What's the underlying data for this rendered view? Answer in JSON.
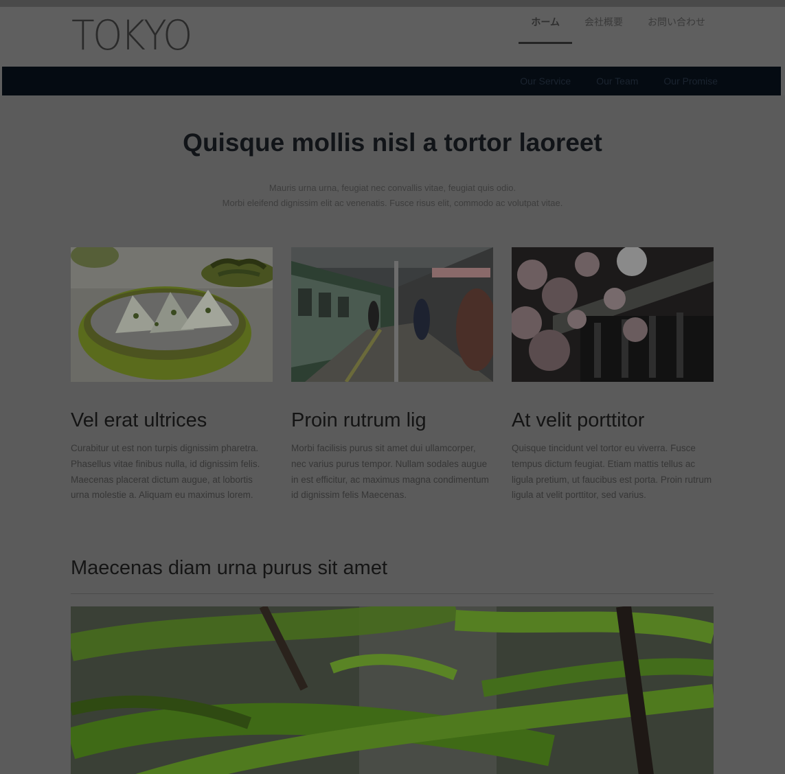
{
  "brand": {
    "logo": "TOKYO"
  },
  "main_nav": [
    {
      "label": "ホーム",
      "active": true
    },
    {
      "label": "会社概要",
      "active": false
    },
    {
      "label": "お問い合わせ",
      "active": false
    }
  ],
  "sub_nav": [
    "Our Service",
    "Our Team",
    "Our Promise"
  ],
  "hero": {
    "title": "Quisque mollis nisl a tortor laoreet",
    "subtitle_line1": "Mauris urna urna, feugiat nec convallis vitae, feugiat quis odio.",
    "subtitle_line2": "Morbi eleifend dignissim elit ac venenatis. Fusce risus elit, commodo ac volutpat vitae."
  },
  "cards": [
    {
      "title": "Vel erat ultrices",
      "body": "Curabitur ut est non turpis dignissim pharetra. Phasellus vitae finibus nulla, id dignissim felis. Maecenas placerat dictum augue, at lobortis urna molestie a. Aliquam eu maximus lorem.",
      "image": "food-bowl-photo"
    },
    {
      "title": "Proin rutrum lig",
      "body": "Morbi facilisis purus sit amet dui ullamcorper, nec varius purus tempor. Nullam sodales augue in est efficitur, ac maximus magna condimentum id dignissim felis Maecenas.",
      "image": "train-platform-photo"
    },
    {
      "title": "At velit porttitor",
      "body": "Quisque tincidunt vel tortor eu viverra. Fusce tempus dictum feugiat. Etiam mattis tellus ac ligula pretium, ut faucibus est porta. Proin rutrum ligula at velit porttitor, sed varius.",
      "image": "cherry-blossom-photo"
    }
  ],
  "section": {
    "title": "Maecenas diam urna purus sit amet"
  },
  "colors": {
    "nav_bar": "#050b12",
    "text_dark": "#111418",
    "overlay_gray": "#5e5e5e"
  }
}
